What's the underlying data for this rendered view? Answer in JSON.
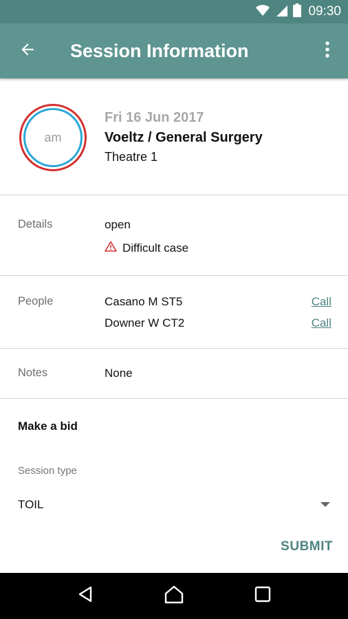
{
  "status_bar": {
    "time": "09:30",
    "icons": [
      "wifi-icon",
      "signal-icon",
      "battery-icon"
    ]
  },
  "app_bar": {
    "title": "Session Information",
    "back_icon": "arrow-back-icon",
    "menu_icon": "more-vert-icon"
  },
  "session": {
    "badge_text": "am",
    "date": "Fri 16 Jun 2017",
    "title": "Voeltz / General Surgery",
    "location": "Theatre 1"
  },
  "details": {
    "label": "Details",
    "status": "open",
    "warning_icon": "warning-triangle-icon",
    "warning_text": "Difficult case"
  },
  "people": {
    "label": "People",
    "items": [
      {
        "name": "Casano M ST5",
        "action": "Call"
      },
      {
        "name": "Downer W CT2",
        "action": "Call"
      }
    ]
  },
  "notes": {
    "label": "Notes",
    "value": "None"
  },
  "bid": {
    "heading": "Make a bid",
    "session_type_label": "Session type",
    "session_type_value": "TOIL",
    "submit_label": "SUBMIT"
  },
  "nav_bar": {
    "icons": [
      "back-triangle-icon",
      "home-icon",
      "recents-icon"
    ]
  },
  "colors": {
    "status_bar": "#4f8580",
    "app_bar": "#5f9590",
    "accent": "#4f8580",
    "badge_outer": "#d32f2f",
    "badge_inner": "#2ba7d6",
    "warning": "#d32f2f"
  }
}
